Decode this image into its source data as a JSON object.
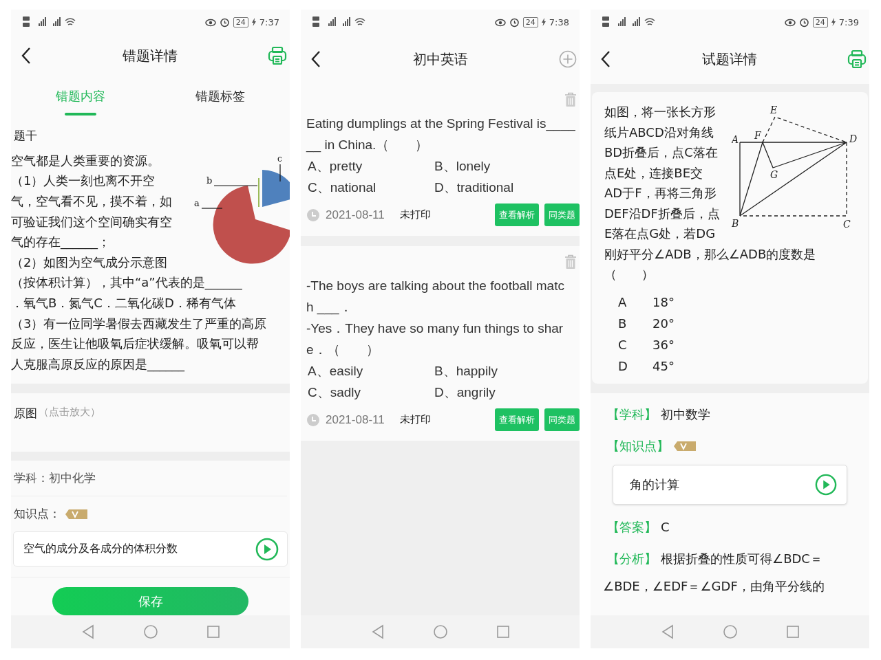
{
  "mistake_detail": {
    "status_bar": {
      "battery": "24",
      "time": "7:37"
    },
    "header": {
      "title": "错题详情"
    },
    "tabs": [
      {
        "label": "错题内容",
        "selected": true
      },
      {
        "label": "错题标签",
        "selected": false
      }
    ],
    "stem_label": "题干",
    "stem_lines": [
      "空气都是人类重要的资源。",
      "（1）人类一刻也离不开空",
      "气，空气看不见，摸不着，如",
      "可验证我们这个空间确实有空",
      "气的存在______；",
      "（2）如图为空气成分示意图",
      "（按体积计算），其中“a”代表的是______",
      "．氧气B．氮气C．二氧化碳D．稀有气体",
      "（3）有一位同学暑假去西藏发生了严重的高原",
      "反应，医生让他吸氧后症状缓解。吸氧可以帮",
      "人克服高原反应的原因是______"
    ],
    "figure_labels": [
      "c",
      "b",
      "a"
    ],
    "original_image": {
      "label": "原图",
      "hint": "（点击放大）"
    },
    "subject": "学科：初中化学",
    "knowledge_label": "知识点：",
    "knowledge_item": "空气的成分及各成分的体积分数",
    "save_button": "保存"
  },
  "question_list": {
    "status_bar": {
      "battery": "24",
      "time": "7:38"
    },
    "header": {
      "title": "初中英语"
    },
    "questions": [
      {
        "lines": [
          "Eating dumplings at the Spring Festival is____",
          "__ in China.（　　）"
        ],
        "options": [
          "A、pretty",
          "B、lonely",
          "C、national",
          "D、traditional"
        ],
        "date": "2021-08-11",
        "print_status": "未打印",
        "buttons": [
          "查看解析",
          "同类题"
        ]
      },
      {
        "lines": [
          "-The boys are talking about the football matc",
          "h ___．",
          "-Yes．They have so many fun things to shar",
          "e．（　　）"
        ],
        "options": [
          "A、easily",
          "B、happily",
          "C、sadly",
          "D、angrily"
        ],
        "date": "2021-08-11",
        "print_status": "未打印",
        "buttons": [
          "查看解析",
          "同类题"
        ]
      }
    ]
  },
  "question_detail": {
    "status_bar": {
      "battery": "24",
      "time": "7:39"
    },
    "header": {
      "title": "试题详情"
    },
    "stem_lines": [
      "如图，将一张长方形",
      "纸片ABCD沿对角线",
      "BD折叠后，点C落在",
      "点E处，连接BE交",
      "AD于F，再将三角形",
      "DEF沿DF折叠后，点",
      "E落在点G处，若DG",
      "刚好平分∠ADB，那么∠ADB的度数是",
      "（　　）"
    ],
    "figure_labels": [
      "E",
      "A",
      "F",
      "D",
      "G",
      "B",
      "C"
    ],
    "options": [
      {
        "letter": "A",
        "value": "18°"
      },
      {
        "letter": "B",
        "value": "20°"
      },
      {
        "letter": "C",
        "value": "36°"
      },
      {
        "letter": "D",
        "value": "45°"
      }
    ],
    "subject": {
      "tag": "【学科】",
      "value": "初中数学"
    },
    "knowledge": {
      "tag": "【知识点】",
      "item": "角的计算"
    },
    "answer": {
      "tag": "【答案】",
      "value": "C"
    },
    "analysis": {
      "tag": "【分析】",
      "lines": [
        "根据折叠的性质可得∠BDC＝",
        "∠BDE，∠EDF＝∠GDF，由角平分线的"
      ]
    }
  }
}
